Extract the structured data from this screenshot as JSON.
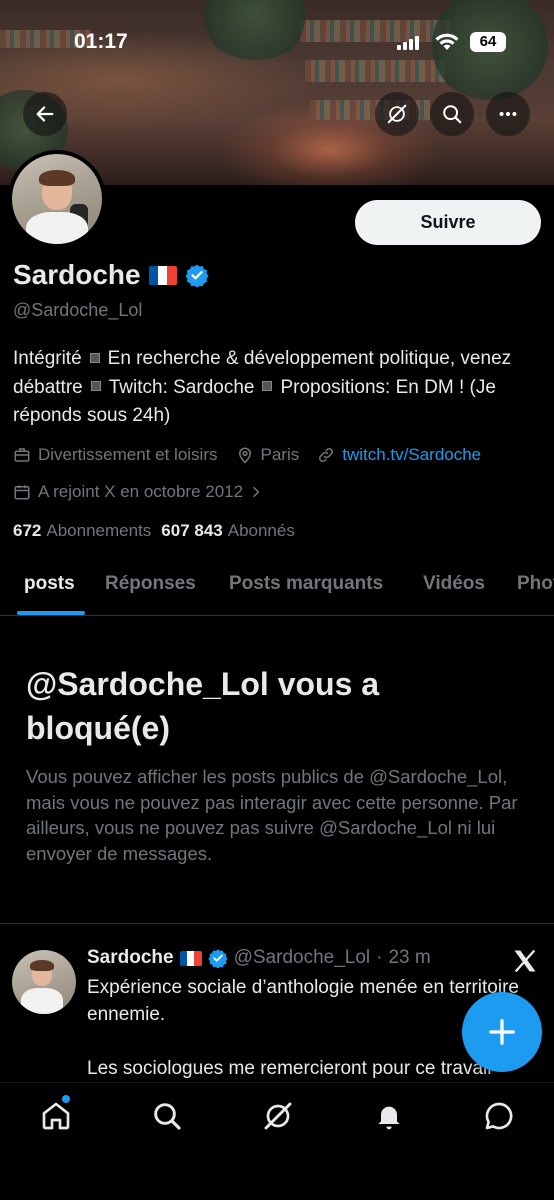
{
  "status_bar": {
    "time": "01:17",
    "battery": "64"
  },
  "banner": {
    "back_icon": "arrow-left-icon",
    "grok_icon": "grok-icon",
    "search_icon": "search-icon",
    "more_icon": "more-horizontal-icon"
  },
  "profile": {
    "follow_label": "Suivre",
    "name": "Sardoche",
    "flag": "france-flag",
    "handle": "@Sardoche_Lol",
    "bio_parts": [
      "Intégrité",
      "En recherche & développement politique, venez débattre",
      "Twitch: Sardoche",
      "Propositions: En DM ! (Je réponds sous 24h)"
    ],
    "category": "Divertissement et loisirs",
    "location": "Paris",
    "website": "twitch.tv/Sardoche",
    "joined": "A rejoint X en octobre 2012",
    "following_count": "672",
    "following_label": "Abonnements",
    "followers_count": "607 843",
    "followers_label": "Abonnés"
  },
  "tabs": [
    "posts",
    "Réponses",
    "Posts marquants",
    "Vidéos",
    "Photos"
  ],
  "blocked": {
    "title": "@Sardoche_Lol vous a bloqué(e)",
    "text": "Vous pouvez afficher les posts publics de @Sardoche_Lol, mais vous ne pouvez pas interagir avec cette personne. Par ailleurs, vous ne pouvez pas suivre @Sardoche_Lol ni lui envoyer de messages."
  },
  "post": {
    "name": "Sardoche",
    "handle": "@Sardoche_Lol",
    "separator": "·",
    "time": "23 m",
    "line1": "Expérience sociale d’anthologie menée en territoire ennemie.",
    "line2": "Les sociologues me remercieront pour ce travail"
  },
  "colors": {
    "accent": "#1d9bf0",
    "background": "#000000",
    "text": "#e7e9ea",
    "muted": "#71767b"
  },
  "bottom_nav": [
    "home-icon",
    "search-icon",
    "grok-icon",
    "notifications-icon",
    "messages-icon"
  ]
}
